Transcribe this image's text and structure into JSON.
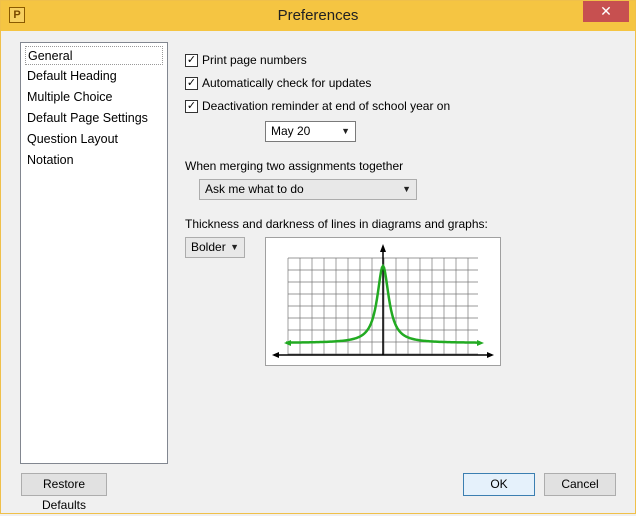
{
  "window": {
    "title": "Preferences",
    "app_icon_glyph": "P",
    "close_glyph": "✕"
  },
  "nav": {
    "items": [
      {
        "label": "General",
        "selected": true
      },
      {
        "label": "Default Heading"
      },
      {
        "label": "Multiple Choice"
      },
      {
        "label": "Default Page Settings"
      },
      {
        "label": "Question Layout"
      },
      {
        "label": "Notation"
      }
    ]
  },
  "general": {
    "print_page_numbers": {
      "label": "Print page numbers",
      "checked": true
    },
    "auto_update": {
      "label": "Automatically check for updates",
      "checked": true
    },
    "deactivation": {
      "label": "Deactivation reminder at end of school year on",
      "checked": true
    },
    "deactivation_date": "May 20",
    "merge_label": "When merging two assignments together",
    "merge_value": "Ask me what to do",
    "thickness_label": "Thickness and darkness of lines in diagrams and graphs:",
    "thickness_value": "Bolder",
    "check_glyph": "✓",
    "dropdown_glyph": "▼"
  },
  "buttons": {
    "restore": "Restore Defaults",
    "ok": "OK",
    "cancel": "Cancel"
  },
  "colors": {
    "titlebar": "#f5c542",
    "curve": "#22aa22",
    "close": "#c75050"
  },
  "icons": [
    "app-icon",
    "close-icon",
    "checkmark-icon",
    "chevron-down-icon"
  ]
}
